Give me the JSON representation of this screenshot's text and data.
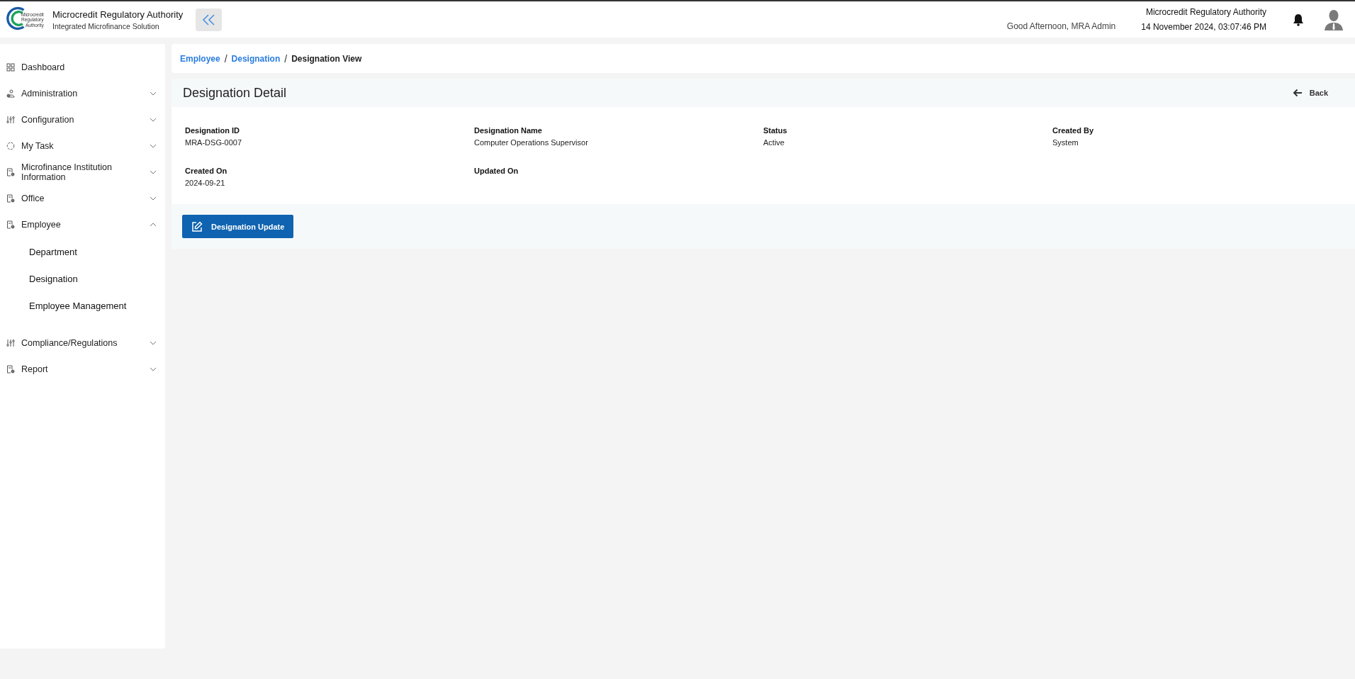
{
  "header": {
    "logo_lines": [
      "Microcredit",
      "Regulatory",
      "Authority"
    ],
    "title": "Microcredit Regulatory Authority",
    "subtitle": "Integrated Microfinance Solution",
    "greeting": "Good Afternoon, MRA Admin",
    "org": "Microcredit Regulatory Authority",
    "datetime": "14 November 2024, 03:07:46 PM"
  },
  "sidebar": {
    "items": [
      {
        "label": "Dashboard",
        "kind": "link"
      },
      {
        "label": "Administration",
        "kind": "group",
        "expanded": false
      },
      {
        "label": "Configuration",
        "kind": "group",
        "expanded": false
      },
      {
        "label": "My Task",
        "kind": "group",
        "expanded": false
      },
      {
        "label": "Microfinance Institution Information",
        "kind": "group",
        "expanded": false
      },
      {
        "label": "Office",
        "kind": "group",
        "expanded": false
      },
      {
        "label": "Employee",
        "kind": "group",
        "expanded": true,
        "children": [
          {
            "label": "Department"
          },
          {
            "label": "Designation"
          },
          {
            "label": "Employee Management"
          }
        ]
      },
      {
        "label": "Compliance/Regulations",
        "kind": "group",
        "expanded": false
      },
      {
        "label": "Report",
        "kind": "group",
        "expanded": false
      }
    ]
  },
  "breadcrumb_separator": "/",
  "breadcrumb": [
    {
      "label": "Employee",
      "link": true
    },
    {
      "label": "Designation",
      "link": true
    },
    {
      "label": "Designation View",
      "link": false
    }
  ],
  "detail": {
    "title": "Designation Detail",
    "back": "Back",
    "fields": [
      {
        "label": "Designation ID",
        "value": "MRA-DSG-0007"
      },
      {
        "label": "Designation Name",
        "value": "Computer Operations Supervisor"
      },
      {
        "label": "Status",
        "value": "Active"
      },
      {
        "label": "Created By",
        "value": "System"
      },
      {
        "label": "Created On",
        "value": "2024-09-21"
      },
      {
        "label": "Updated On"
      }
    ],
    "update_button": "Designation Update"
  }
}
